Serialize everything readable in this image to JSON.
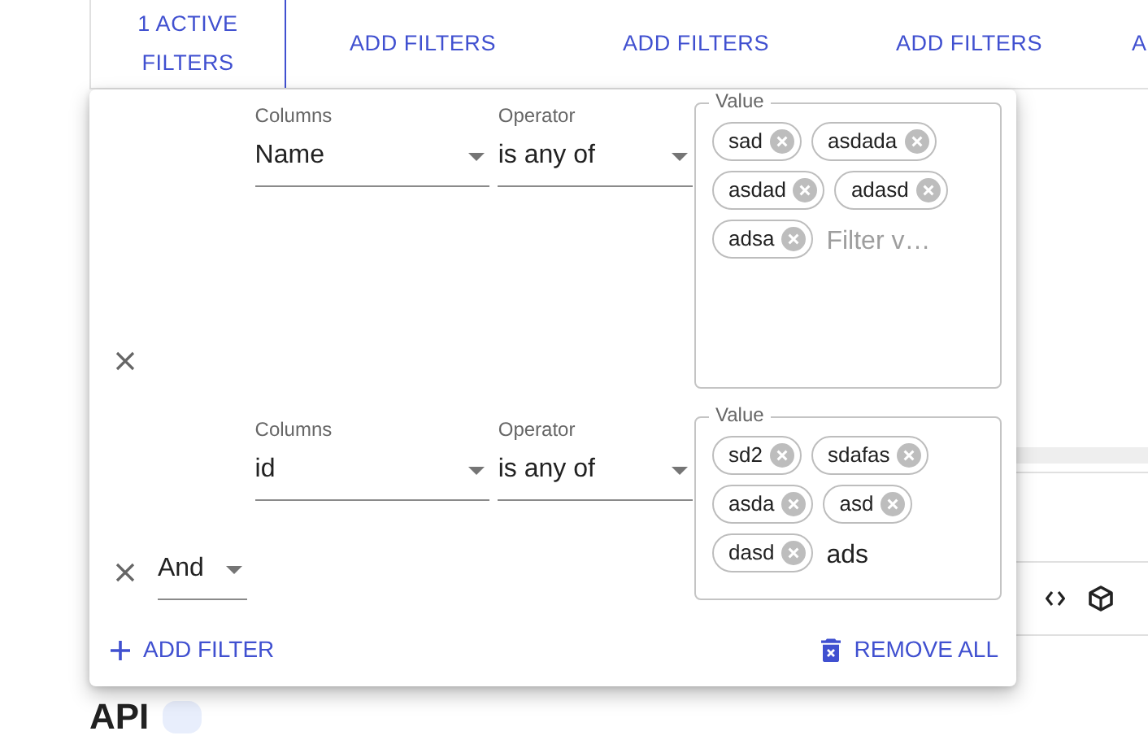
{
  "toolbar": {
    "buttons": [
      {
        "label": "1 ACTIVE FILTERS",
        "kind": "active"
      },
      {
        "label": "ADD FILTERS",
        "kind": "plain"
      },
      {
        "label": "ADD FILTERS",
        "kind": "plain"
      },
      {
        "label": "ADD FILTERS",
        "kind": "plain"
      },
      {
        "label": "A",
        "kind": "plain"
      }
    ]
  },
  "filter_panel": {
    "filters": [
      {
        "column_label": "Columns",
        "column": "Name",
        "operator_label": "Operator",
        "operator": "is any of",
        "value_label": "Value",
        "values": [
          "sad",
          "asdada",
          "asdad",
          "adasd",
          "adsa"
        ],
        "input_placeholder": "Filter v…"
      },
      {
        "logic_operator": "And",
        "column_label": "Columns",
        "column": "id",
        "operator_label": "Operator",
        "operator": "is any of",
        "value_label": "Value",
        "values": [
          "sd2",
          "sdafas",
          "asda",
          "asd",
          "dasd"
        ],
        "input_value": "ads"
      }
    ],
    "add_button": "ADD FILTER",
    "remove_button": "REMOVE ALL"
  },
  "page": {
    "heading": "API"
  }
}
